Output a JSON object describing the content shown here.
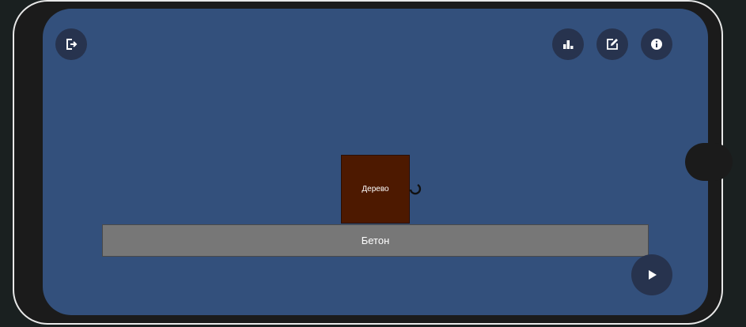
{
  "toolbar": {
    "exit_icon": "exit-icon",
    "stats_icon": "bar-chart-icon",
    "edit_icon": "edit-icon",
    "info_icon": "info-icon"
  },
  "scene": {
    "wood_block_label": "Дерево",
    "concrete_block_label": "Бетон"
  },
  "controls": {
    "play_icon": "play-icon"
  },
  "colors": {
    "screen_bg": "#33507c",
    "button_bg": "#27334e",
    "wood": "#4d1900",
    "concrete": "#777777"
  }
}
